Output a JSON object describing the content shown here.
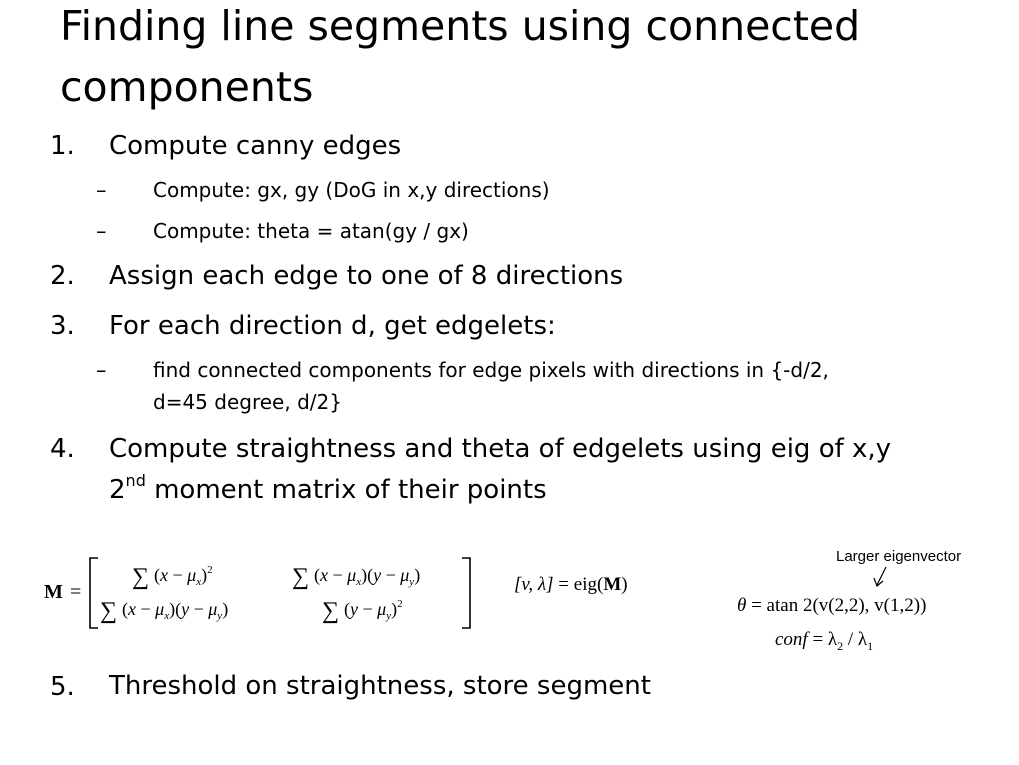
{
  "slide": {
    "title": "Finding line segments using connected components"
  },
  "steps": [
    {
      "number": "1.",
      "text": "Compute canny edges"
    },
    {
      "number": "2.",
      "text": "Assign each edge to one of 8 directions"
    },
    {
      "number": "3.",
      "text": "For each direction d, get edgelets:"
    },
    {
      "number": "4.",
      "text_line1": "Compute straightness and theta of edgelets using eig of x,y",
      "text_line2_prefix": "2",
      "text_line2_sup": "nd",
      "text_line2_rest": " moment matrix of their points"
    },
    {
      "number": "5.",
      "text": "Threshold on straightness, store segment"
    }
  ],
  "substeps": {
    "step1": [
      {
        "bullet": "–",
        "text": "Compute: gx, gy (DoG in x,y directions)"
      },
      {
        "bullet": "–",
        "text": "Compute: theta = atan(gy / gx)"
      }
    ],
    "step3": [
      {
        "bullet": "–",
        "text_line1": "find connected components for edge pixels with directions in {-d/2,",
        "text_line2": "d=45 degree, d/2}"
      }
    ]
  },
  "equations": {
    "matrix_lhs": "M",
    "sum_symbol": "∑",
    "x": "x",
    "y": "y",
    "mu": "μ",
    "sub_x": "x",
    "sub_y": "y",
    "squared": "2",
    "eig_lhs": "[v, λ]",
    "eig_rhs": "= eig(",
    "eig_arg": "M",
    "eig_close": ")",
    "theta_lhs": "θ",
    "theta_rhs": "= atan 2(v(2,2), v(1,2))",
    "conf_lhs": "conf",
    "conf_rhs": "= λ",
    "conf_sub2": "2",
    "conf_slash": " / λ",
    "conf_sub1": "1",
    "annotation": "Larger eigenvector"
  }
}
